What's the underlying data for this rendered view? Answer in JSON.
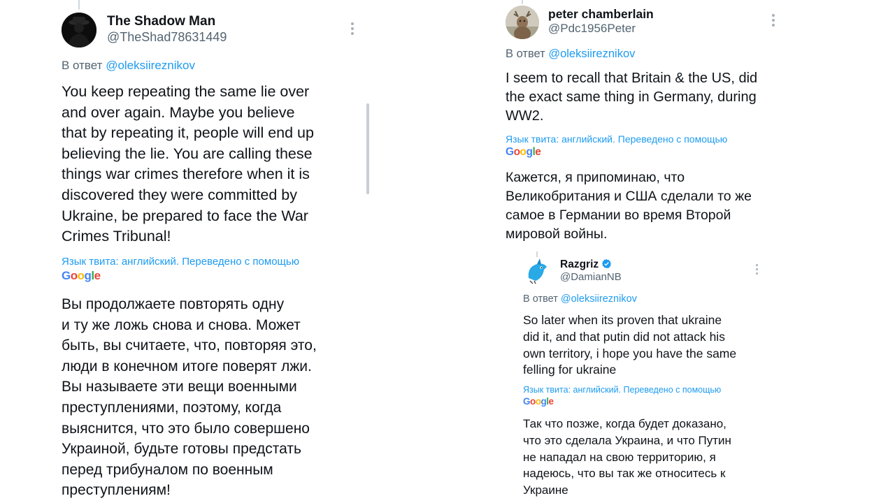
{
  "left_tweet": {
    "name": "The Shadow Man",
    "handle": "@TheShad78631449",
    "reply_prefix": "В ответ",
    "reply_mention": "@oleksiireznikov",
    "lines": [
      "You keep repeating the same lie over",
      "and over again. Maybe you believe",
      "that by repeating it, people will end up",
      "believing the lie. You are calling these",
      "things war crimes therefore when it is",
      "discovered they were committed by",
      "Ukraine, be prepared to face the War",
      "Crimes Tribunal!"
    ],
    "translate_label": "Язык твита: английский. Переведено с помощью",
    "google": "Google",
    "translation_lines": [
      "Вы продолжаете повторять одну",
      "и ту же ложь снова и снова. Может",
      "быть, вы считаете, что, повторяя это,",
      "люди в конечном итоге поверят лжи.",
      "Вы называете эти вещи военными",
      "преступлениями, поэтому, когда",
      "выяснится, что это было совершено",
      "Украиной, будьте готовы предстать",
      "перед трибуналом по военным",
      "преступлениям!"
    ]
  },
  "right_tweet": {
    "name": "peter chamberlain",
    "handle": "@Pdc1956Peter",
    "reply_prefix": "В ответ",
    "reply_mention": "@oleksiireznikov",
    "lines": [
      "I seem to recall that Britain & the US, did",
      "the exact same thing in Germany, during",
      "WW2."
    ],
    "translate_label": "Язык твита: английский. Переведено с помощью",
    "google": "Google",
    "translation_lines": [
      "Кажется, я припоминаю, что",
      "Великобритания и США сделали то же",
      "самое в Германии во время Второй",
      "мировой войны."
    ]
  },
  "nested_tweet": {
    "name": "Razgriz",
    "handle": "@DamianNB",
    "verified": true,
    "reply_prefix": "В ответ",
    "reply_mention": "@oleksiireznikov",
    "lines": [
      "So later when its proven that ukraine",
      "did it, and that putin did not attack his",
      "own territory, i hope you have the same",
      "felling for ukraine"
    ],
    "translate_label": "Язык твита: английский. Переведено с помощью",
    "google": "Google",
    "translation_lines": [
      "Так что позже, когда будет доказано,",
      "что это сделала Украина, и что Путин",
      "не нападал на свою территорию, я",
      "надеюсь, что вы так же относитесь к",
      "Украине"
    ]
  },
  "colors": {
    "link": "#1d9bf0",
    "text": "#0f1419",
    "muted": "#536471",
    "verified": "#1d9bf0"
  }
}
